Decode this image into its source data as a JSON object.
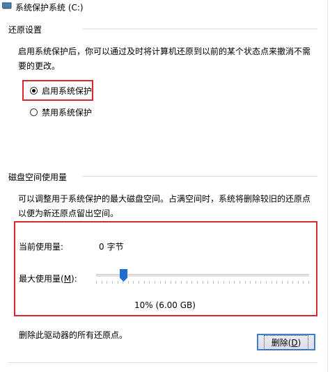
{
  "window": {
    "title": "系统保护系统 (C:)"
  },
  "restore_settings": {
    "group_title": "还原设置",
    "description": "启用系统保护后，你可以通过及时将计算机还原到以前的某个状态点来撤消不需要的更改。",
    "options": [
      {
        "label": "启用系统保护",
        "selected": true
      },
      {
        "label": "禁用系统保护",
        "selected": false
      }
    ]
  },
  "disk_usage": {
    "group_title": "磁盘空间使用量",
    "description": "可以调整用于系统保护的最大磁盘空间。占满空间时，系统将删除较旧的还原点以便为新还原点留出空间。",
    "current_label": "当前使用量:",
    "current_value": "0 字节",
    "max_label": "最大使用量(M):",
    "max_label_plain": "最大使用量(",
    "max_label_accel": "M",
    "max_label_tail": "):",
    "slider_value_fraction": 0.1,
    "slider_readout": "10% (6.00 GB)"
  },
  "delete": {
    "description": "删除此驱动器的所有还原点。",
    "button_label_prefix": "删除(",
    "button_label_accel": "D",
    "button_label_suffix": ")"
  },
  "colors": {
    "highlight": "#d8282e",
    "accent": "#1e6fd0"
  }
}
